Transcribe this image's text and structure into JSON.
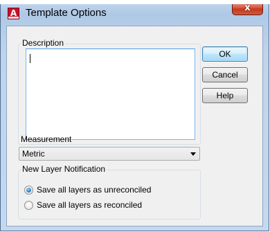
{
  "window": {
    "title": "Template Options",
    "app_icon_letter": "A",
    "close_glyph": "x"
  },
  "description": {
    "group_label": "Description",
    "value": ""
  },
  "buttons": {
    "ok_label": "OK",
    "cancel_label": "Cancel",
    "help_label": "Help"
  },
  "measurement": {
    "label": "Measurement",
    "selected": "Metric"
  },
  "notification": {
    "group_label": "New Layer Notification",
    "options": [
      {
        "label": "Save all layers as unreconciled",
        "checked": true
      },
      {
        "label": "Save all layers as reconciled",
        "checked": false
      }
    ]
  },
  "colors": {
    "title_bar": "#b5cde8",
    "close_button": "#c23a1f",
    "dialog_face": "#f0f0f0",
    "default_button_border": "#3c7fb1",
    "radio_selected": "#2a7fc3"
  },
  "icons": {
    "app": "autocad-icon",
    "close": "close-icon",
    "dropdown": "chevron-down-icon"
  }
}
